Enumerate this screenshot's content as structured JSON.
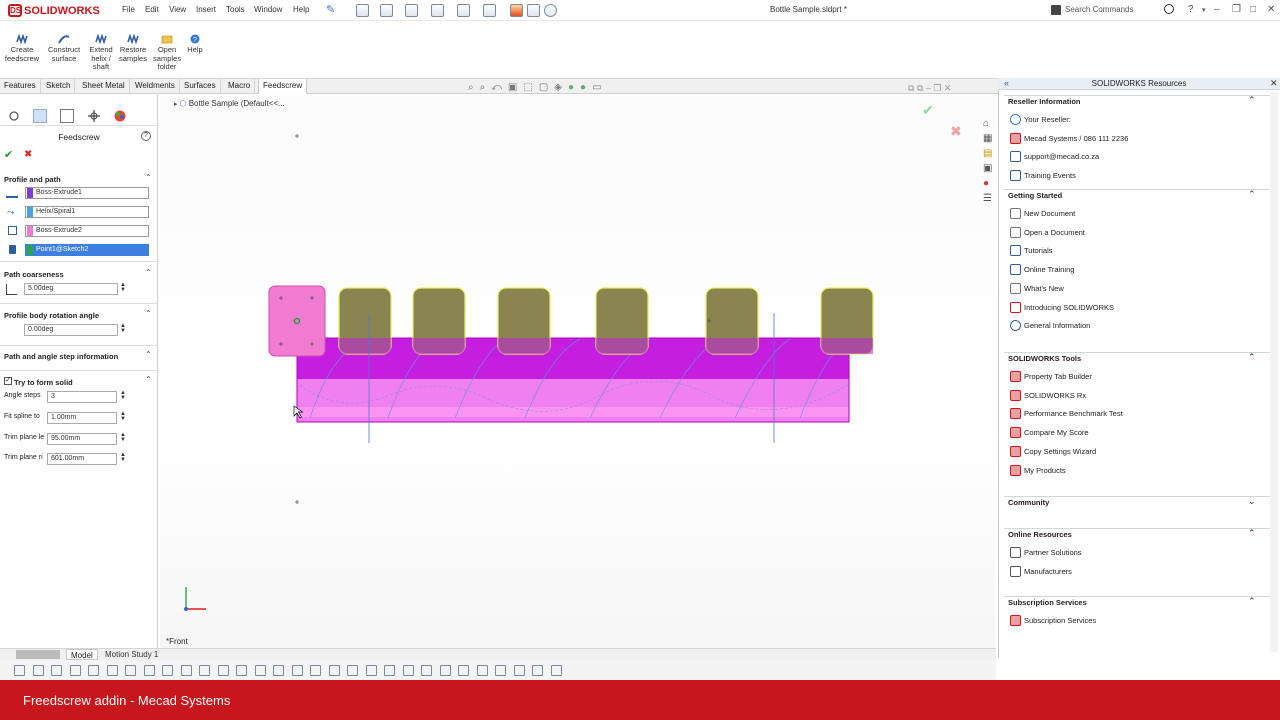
{
  "app": {
    "brand": "SOLIDWORKS",
    "document_title": "Bottle Sample.sldprt *"
  },
  "menu": [
    "File",
    "Edit",
    "View",
    "Insert",
    "Tools",
    "Window",
    "Help"
  ],
  "search": {
    "placeholder": "Search Commands"
  },
  "command_manager": [
    {
      "label": "Create feedscrew",
      "icon": "feedscrew-icon"
    },
    {
      "label": "Construct surface",
      "icon": "surface-icon"
    },
    {
      "label": "Extend helix / shaft",
      "icon": "helix-icon"
    },
    {
      "label": "Restore samples",
      "icon": "restore-icon"
    },
    {
      "label": "Open samples folder",
      "icon": "folder-icon"
    },
    {
      "label": "Help",
      "icon": "help-icon"
    }
  ],
  "tabs": [
    {
      "label": "Features",
      "active": false
    },
    {
      "label": "Sketch",
      "active": false
    },
    {
      "label": "Sheet Metal",
      "active": false
    },
    {
      "label": "Weldments",
      "active": false
    },
    {
      "label": "Surfaces",
      "active": false
    },
    {
      "label": "Macro",
      "active": false
    },
    {
      "label": "Feedscrew",
      "active": true
    }
  ],
  "property_manager": {
    "title": "Feedscrew",
    "profile_and_path": {
      "header": "Profile and path",
      "selections": [
        {
          "label": "Boss-Extrude1",
          "color": "#7b3fd6",
          "icon": "profile-icon"
        },
        {
          "label": "Helix/Spiral1",
          "color": "#4aa3df",
          "icon": "helix-icon"
        },
        {
          "label": "Boss-Extrude2",
          "color": "#f07bd0",
          "icon": "body-icon"
        },
        {
          "label": "Point1@Sketch2",
          "color": "#2aa84a",
          "icon": "point-icon",
          "highlighted": true
        }
      ]
    },
    "path_coarseness": {
      "header": "Path coarseness",
      "value": "5.00deg"
    },
    "profile_body_rotation": {
      "header": "Profile body rotation angle",
      "value": "0.00deg"
    },
    "path_angle_step": {
      "header": "Path and angle step information"
    },
    "try_to_form_solid": {
      "header": "Try to form solid",
      "fields": [
        {
          "label": "Angle steps",
          "value": "3"
        },
        {
          "label": "Fit spline to",
          "value": "1.00mm"
        },
        {
          "label": "Trim plane le",
          "value": "95.00mm"
        },
        {
          "label": "Trim plane ri",
          "value": "601.00mm"
        }
      ]
    }
  },
  "graphics": {
    "breadcrumb": "Bottle Sample  (Default<<...",
    "view_label": "*Front"
  },
  "resources": {
    "title": "SOLIDWORKS Resources",
    "groups": [
      {
        "name": "Reseller Information",
        "expanded": true,
        "items": [
          {
            "label": "Your Reseller:",
            "icon": "globe-icon"
          },
          {
            "label": "Mecad Systems / 086 111 2236",
            "icon": "reseller-logo-icon"
          },
          {
            "label": "support@mecad.co.za",
            "icon": "email-icon"
          },
          {
            "label": "Training Events",
            "icon": "training-icon"
          }
        ]
      },
      {
        "name": "Getting Started",
        "expanded": true,
        "items": [
          {
            "label": "New Document",
            "icon": "document-icon"
          },
          {
            "label": "Open a Document",
            "icon": "open-icon"
          },
          {
            "label": "Tutorials",
            "icon": "tutorial-icon"
          },
          {
            "label": "Online Training",
            "icon": "online-training-icon"
          },
          {
            "label": "What's New",
            "icon": "whats-new-icon"
          },
          {
            "label": "Introducing SOLIDWORKS",
            "icon": "solidworks-icon"
          },
          {
            "label": "General Information",
            "icon": "info-icon"
          }
        ]
      },
      {
        "name": "SOLIDWORKS Tools",
        "expanded": true,
        "items": [
          {
            "label": "Property Tab Builder",
            "icon": "sw-tool-icon"
          },
          {
            "label": "SOLIDWORKS Rx",
            "icon": "sw-tool-icon"
          },
          {
            "label": "Performance Benchmark Test",
            "icon": "sw-tool-icon"
          },
          {
            "label": "Compare My Score",
            "icon": "sw-tool-icon"
          },
          {
            "label": "Copy Settings Wizard",
            "icon": "sw-tool-icon"
          },
          {
            "label": "My Products",
            "icon": "sw-tool-icon"
          }
        ]
      },
      {
        "name": "Community",
        "expanded": false,
        "items": []
      },
      {
        "name": "Online Resources",
        "expanded": true,
        "items": [
          {
            "label": "Partner Solutions",
            "icon": "handshake-icon"
          },
          {
            "label": "Manufacturers",
            "icon": "handshake-icon"
          }
        ]
      },
      {
        "name": "Subscription Services",
        "expanded": true,
        "items": [
          {
            "label": "Subscription Services",
            "icon": "sw-tool-icon"
          }
        ]
      }
    ]
  },
  "bottom_tabs": [
    {
      "label": "Model"
    },
    {
      "label": "Motion Study 1"
    }
  ],
  "banner": {
    "text": "Freedscrew addin - Mecad Systems"
  },
  "colors": {
    "accent_red": "#c8161d",
    "body_purple": "#c41fe0",
    "profile_pink": "#f07bd0",
    "profile_olive": "#8a8450"
  }
}
